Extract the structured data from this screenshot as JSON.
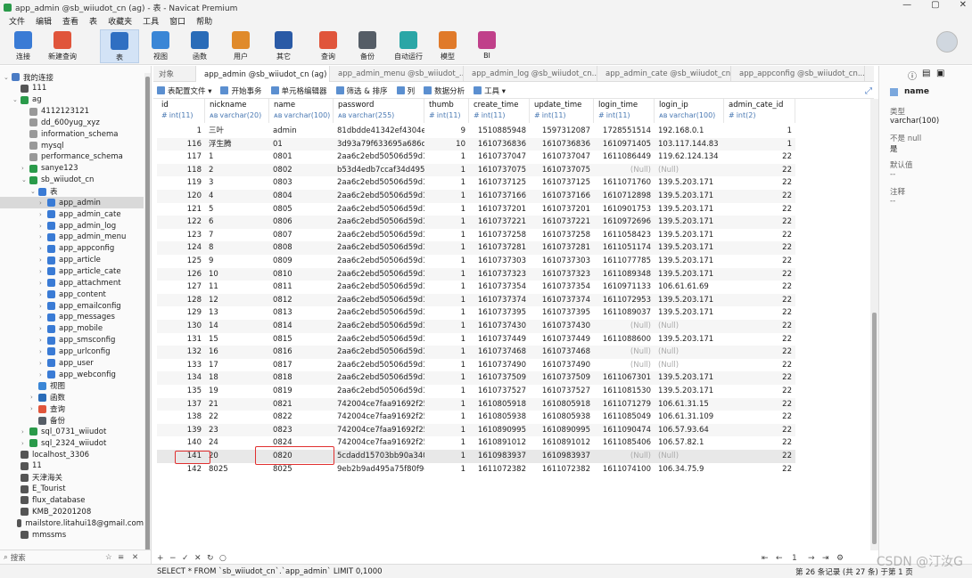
{
  "window": {
    "title": "app_admin @sb_wiiudot_cn (ag) - 表 - Navicat Premium"
  },
  "menu": [
    "文件",
    "编辑",
    "查看",
    "表",
    "收藏夹",
    "工具",
    "窗口",
    "帮助"
  ],
  "toolbar": [
    {
      "label": "连接",
      "color": "#3a7bd5"
    },
    {
      "label": "新建查询",
      "color": "#e0553b"
    },
    {
      "label": "表",
      "color": "#2f6fc2"
    },
    {
      "label": "视图",
      "color": "#3a86d6"
    },
    {
      "label": "函数",
      "color": "#2a6cb8"
    },
    {
      "label": "用户",
      "color": "#e08a2a"
    },
    {
      "label": "其它",
      "color": "#2a5aa6"
    },
    {
      "label": "查询",
      "color": "#e0553b"
    },
    {
      "label": "备份",
      "color": "#555d66"
    },
    {
      "label": "自动运行",
      "color": "#2aa6a6"
    },
    {
      "label": "模型",
      "color": "#e07a2a"
    },
    {
      "label": "BI",
      "color": "#c0408a"
    }
  ],
  "sidebar": {
    "items": [
      {
        "label": "我的连接",
        "indent": 0,
        "toggle": "⌄",
        "color": "#4a7bc4"
      },
      {
        "label": "111",
        "indent": 1,
        "toggle": "",
        "color": "#555"
      },
      {
        "label": "ag",
        "indent": 1,
        "toggle": "⌄",
        "color": "#2a9a4a"
      },
      {
        "label": "4112123121",
        "indent": 2,
        "toggle": "",
        "color": "#999"
      },
      {
        "label": "dd_600yug_xyz",
        "indent": 2,
        "toggle": "",
        "color": "#999"
      },
      {
        "label": "information_schema",
        "indent": 2,
        "toggle": "",
        "color": "#999"
      },
      {
        "label": "mysql",
        "indent": 2,
        "toggle": "",
        "color": "#999"
      },
      {
        "label": "performance_schema",
        "indent": 2,
        "toggle": "",
        "color": "#999"
      },
      {
        "label": "sanye123",
        "indent": 2,
        "toggle": "›",
        "color": "#2a9a4a"
      },
      {
        "label": "sb_wiiudot_cn",
        "indent": 2,
        "toggle": "⌄",
        "color": "#2a9a4a"
      },
      {
        "label": "表",
        "indent": 3,
        "toggle": "⌄",
        "color": "#3a7bd5"
      },
      {
        "label": "app_admin",
        "indent": 4,
        "toggle": "›",
        "color": "#3a7bd5",
        "selected": true
      },
      {
        "label": "app_admin_cate",
        "indent": 4,
        "toggle": "›",
        "color": "#3a7bd5"
      },
      {
        "label": "app_admin_log",
        "indent": 4,
        "toggle": "›",
        "color": "#3a7bd5"
      },
      {
        "label": "app_admin_menu",
        "indent": 4,
        "toggle": "›",
        "color": "#3a7bd5"
      },
      {
        "label": "app_appconfig",
        "indent": 4,
        "toggle": "›",
        "color": "#3a7bd5"
      },
      {
        "label": "app_article",
        "indent": 4,
        "toggle": "›",
        "color": "#3a7bd5"
      },
      {
        "label": "app_article_cate",
        "indent": 4,
        "toggle": "›",
        "color": "#3a7bd5"
      },
      {
        "label": "app_attachment",
        "indent": 4,
        "toggle": "›",
        "color": "#3a7bd5"
      },
      {
        "label": "app_content",
        "indent": 4,
        "toggle": "›",
        "color": "#3a7bd5"
      },
      {
        "label": "app_emailconfig",
        "indent": 4,
        "toggle": "›",
        "color": "#3a7bd5"
      },
      {
        "label": "app_messages",
        "indent": 4,
        "toggle": "›",
        "color": "#3a7bd5"
      },
      {
        "label": "app_mobile",
        "indent": 4,
        "toggle": "›",
        "color": "#3a7bd5"
      },
      {
        "label": "app_smsconfig",
        "indent": 4,
        "toggle": "›",
        "color": "#3a7bd5"
      },
      {
        "label": "app_urlconfig",
        "indent": 4,
        "toggle": "›",
        "color": "#3a7bd5"
      },
      {
        "label": "app_user",
        "indent": 4,
        "toggle": "›",
        "color": "#3a7bd5"
      },
      {
        "label": "app_webconfig",
        "indent": 4,
        "toggle": "›",
        "color": "#3a7bd5"
      },
      {
        "label": "视图",
        "indent": 3,
        "toggle": "",
        "color": "#3a86d6"
      },
      {
        "label": "函数",
        "indent": 3,
        "toggle": "›",
        "color": "#2a6cb8"
      },
      {
        "label": "查询",
        "indent": 3,
        "toggle": "›",
        "color": "#e0553b"
      },
      {
        "label": "备份",
        "indent": 3,
        "toggle": "",
        "color": "#555d66"
      },
      {
        "label": "sql_0731_wiiudot",
        "indent": 2,
        "toggle": "›",
        "color": "#2a9a4a"
      },
      {
        "label": "sql_2324_wiiudot",
        "indent": 2,
        "toggle": "›",
        "color": "#2a9a4a"
      },
      {
        "label": "localhost_3306",
        "indent": 1,
        "toggle": "",
        "color": "#555"
      },
      {
        "label": "11",
        "indent": 1,
        "toggle": "",
        "color": "#555"
      },
      {
        "label": "天津海关",
        "indent": 1,
        "toggle": "",
        "color": "#555"
      },
      {
        "label": "E_Tourist",
        "indent": 1,
        "toggle": "",
        "color": "#555"
      },
      {
        "label": "flux_database",
        "indent": 1,
        "toggle": "",
        "color": "#555"
      },
      {
        "label": "KMB_20201208",
        "indent": 1,
        "toggle": "",
        "color": "#555"
      },
      {
        "label": "mailstore.litahui18@gmail.com",
        "indent": 1,
        "toggle": "",
        "color": "#555"
      },
      {
        "label": "mmssms",
        "indent": 1,
        "toggle": "",
        "color": "#555"
      }
    ],
    "search_placeholder": "搜索"
  },
  "tabs": [
    {
      "label": "对象",
      "active": false,
      "icon": false
    },
    {
      "label": "app_admin @sb_wiiudot_cn (ag) - 表",
      "active": true,
      "icon": true
    },
    {
      "label": "app_admin_menu @sb_wiiudot_...",
      "active": false,
      "icon": true
    },
    {
      "label": "app_admin_log @sb_wiiudot_cn...",
      "active": false,
      "icon": true
    },
    {
      "label": "app_admin_cate @sb_wiiudot_cn...",
      "active": false,
      "icon": true
    },
    {
      "label": "app_appconfig @sb_wiiudot_cn...",
      "active": false,
      "icon": true
    }
  ],
  "subtoolbar": [
    "表配置文件 ▾",
    "开始事务",
    "单元格编辑器",
    "筛选 & 排序",
    "列",
    "数据分析",
    "工具 ▾"
  ],
  "columns": [
    {
      "name": "id",
      "type": "int(11)",
      "icon": "#"
    },
    {
      "name": "nickname",
      "type": "varchar(20)",
      "icon": "ᴀʙ"
    },
    {
      "name": "name",
      "type": "varchar(100)",
      "icon": "ᴀʙ"
    },
    {
      "name": "password",
      "type": "varchar(255)",
      "icon": "ᴀʙ"
    },
    {
      "name": "thumb",
      "type": "int(11)",
      "icon": "#"
    },
    {
      "name": "create_time",
      "type": "int(11)",
      "icon": "#"
    },
    {
      "name": "update_time",
      "type": "int(11)",
      "icon": "#"
    },
    {
      "name": "login_time",
      "type": "int(11)",
      "icon": "#"
    },
    {
      "name": "login_ip",
      "type": "varchar(100)",
      "icon": "ᴀʙ"
    },
    {
      "name": "admin_cate_id",
      "type": "int(2)",
      "icon": "#"
    }
  ],
  "rows": [
    [
      "1",
      "三叶",
      "admin",
      "81dbdde41342ef4304e",
      "9",
      "1510885948",
      "1597312087",
      "1728551514",
      "192.168.0.1",
      "1"
    ],
    [
      "116",
      "浮生腾",
      "01",
      "3d93a79f633695a686c6",
      "10",
      "1610736836",
      "1610736836",
      "1610971405",
      "103.117.144.83",
      "1"
    ],
    [
      "117",
      "1",
      "0801",
      "2aa6c2ebd50506d59d1",
      "1",
      "1610737047",
      "1610737047",
      "1611086449",
      "119.62.124.134",
      "22"
    ],
    [
      "118",
      "2",
      "0802",
      "b53d4edb7ccaf34d4955",
      "1",
      "1610737075",
      "1610737075",
      "(Null)",
      "(Null)",
      "22"
    ],
    [
      "119",
      "3",
      "0803",
      "2aa6c2ebd50506d59d1",
      "1",
      "1610737125",
      "1610737125",
      "1611071760",
      "139.5.203.171",
      "22"
    ],
    [
      "120",
      "4",
      "0804",
      "2aa6c2ebd50506d59d1",
      "1",
      "1610737166",
      "1610737166",
      "1610712898",
      "139.5.203.171",
      "22"
    ],
    [
      "121",
      "5",
      "0805",
      "2aa6c2ebd50506d59d1",
      "1",
      "1610737201",
      "1610737201",
      "1610901753",
      "139.5.203.171",
      "22"
    ],
    [
      "122",
      "6",
      "0806",
      "2aa6c2ebd50506d59d1",
      "1",
      "1610737221",
      "1610737221",
      "1610972696",
      "139.5.203.171",
      "22"
    ],
    [
      "123",
      "7",
      "0807",
      "2aa6c2ebd50506d59d1",
      "1",
      "1610737258",
      "1610737258",
      "1611058423",
      "139.5.203.171",
      "22"
    ],
    [
      "124",
      "8",
      "0808",
      "2aa6c2ebd50506d59d1",
      "1",
      "1610737281",
      "1610737281",
      "1611051174",
      "139.5.203.171",
      "22"
    ],
    [
      "125",
      "9",
      "0809",
      "2aa6c2ebd50506d59d1",
      "1",
      "1610737303",
      "1610737303",
      "1611077785",
      "139.5.203.171",
      "22"
    ],
    [
      "126",
      "10",
      "0810",
      "2aa6c2ebd50506d59d1",
      "1",
      "1610737323",
      "1610737323",
      "1611089348",
      "139.5.203.171",
      "22"
    ],
    [
      "127",
      "11",
      "0811",
      "2aa6c2ebd50506d59d1",
      "1",
      "1610737354",
      "1610737354",
      "1610971133",
      "106.61.61.69",
      "22"
    ],
    [
      "128",
      "12",
      "0812",
      "2aa6c2ebd50506d59d1",
      "1",
      "1610737374",
      "1610737374",
      "1611072953",
      "139.5.203.171",
      "22"
    ],
    [
      "129",
      "13",
      "0813",
      "2aa6c2ebd50506d59d1",
      "1",
      "1610737395",
      "1610737395",
      "1611089037",
      "139.5.203.171",
      "22"
    ],
    [
      "130",
      "14",
      "0814",
      "2aa6c2ebd50506d59d1",
      "1",
      "1610737430",
      "1610737430",
      "(Null)",
      "(Null)",
      "22"
    ],
    [
      "131",
      "15",
      "0815",
      "2aa6c2ebd50506d59d1",
      "1",
      "1610737449",
      "1610737449",
      "1611088600",
      "139.5.203.171",
      "22"
    ],
    [
      "132",
      "16",
      "0816",
      "2aa6c2ebd50506d59d1",
      "1",
      "1610737468",
      "1610737468",
      "(Null)",
      "(Null)",
      "22"
    ],
    [
      "133",
      "17",
      "0817",
      "2aa6c2ebd50506d59d1",
      "1",
      "1610737490",
      "1610737490",
      "(Null)",
      "(Null)",
      "22"
    ],
    [
      "134",
      "18",
      "0818",
      "2aa6c2ebd50506d59d1",
      "1",
      "1610737509",
      "1610737509",
      "1611067301",
      "139.5.203.171",
      "22"
    ],
    [
      "135",
      "19",
      "0819",
      "2aa6c2ebd50506d59d1",
      "1",
      "1610737527",
      "1610737527",
      "1611081530",
      "139.5.203.171",
      "22"
    ],
    [
      "137",
      "21",
      "0821",
      "742004ce7faa91692f25",
      "1",
      "1610805918",
      "1610805918",
      "1611071279",
      "106.61.31.15",
      "22"
    ],
    [
      "138",
      "22",
      "0822",
      "742004ce7faa91692f25",
      "1",
      "1610805938",
      "1610805938",
      "1611085049",
      "106.61.31.109",
      "22"
    ],
    [
      "139",
      "23",
      "0823",
      "742004ce7faa91692f25",
      "1",
      "1610890995",
      "1610890995",
      "1611090474",
      "106.57.93.64",
      "22"
    ],
    [
      "140",
      "24",
      "0824",
      "742004ce7faa91692f25",
      "1",
      "1610891012",
      "1610891012",
      "1611085406",
      "106.57.82.1",
      "22"
    ],
    [
      "141",
      "20",
      "0820",
      "5cdadd15703bb90a340",
      "1",
      "1610983937",
      "1610983937",
      "(Null)",
      "(Null)",
      "22"
    ],
    [
      "142",
      "8025",
      "8025",
      "9eb2b9ad495a75f80f9c",
      "1",
      "1611072382",
      "1611072382",
      "1611074100",
      "106.34.75.9",
      "22"
    ]
  ],
  "current_row": 25,
  "right_panel": {
    "field_name": "name",
    "type_label": "类型",
    "type_value": "varchar(100)",
    "notnull_label": "不是 null",
    "notnull_value": "是",
    "default_label": "默认值",
    "default_value": "--",
    "comment_label": "注释",
    "comment_value": "--"
  },
  "bottom_nav": {
    "page": "1"
  },
  "status": {
    "sql": "SELECT * FROM `sb_wiiudot_cn`.`app_admin` LIMIT 0,1000",
    "record": "第 26 条记录 (共 27 条) 于第 1 页"
  },
  "watermark": "CSDN @汀汝G"
}
